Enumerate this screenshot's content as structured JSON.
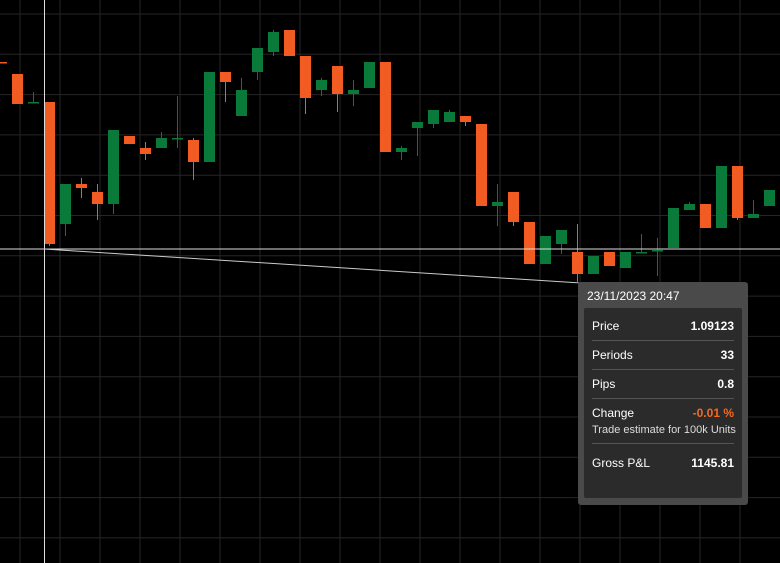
{
  "colors": {
    "background": "#000000",
    "grid": "#262626",
    "bullish": "#0a7a3a",
    "bearish": "#f25c23",
    "crosshair": "#dddddd",
    "negative_change": "#f26a22"
  },
  "chart_data": {
    "type": "candlestick",
    "candles": [
      {
        "dir": "down",
        "open": 1.0956,
        "high": 1.0956,
        "low": 1.0956,
        "close": 1.0956
      },
      {
        "dir": "down",
        "open": 1.0953,
        "high": 1.0953,
        "low": 1.09455,
        "close": 1.09455
      },
      {
        "dir": "flat",
        "open": 1.0946,
        "high": 1.09485,
        "low": 1.0946,
        "close": 1.0946
      },
      {
        "dir": "down",
        "open": 1.0946,
        "high": 1.0946,
        "low": 1.091,
        "close": 1.09105
      },
      {
        "dir": "up",
        "open": 1.09155,
        "high": 1.09255,
        "low": 1.09125,
        "close": 1.09255
      },
      {
        "dir": "down",
        "open": 1.09255,
        "high": 1.0927,
        "low": 1.0922,
        "close": 1.09245
      },
      {
        "dir": "down",
        "open": 1.09235,
        "high": 1.09255,
        "low": 1.09165,
        "close": 1.09205
      },
      {
        "dir": "up",
        "open": 1.09205,
        "high": 1.0938,
        "low": 1.0918,
        "close": 1.0939
      },
      {
        "dir": "down",
        "open": 1.09375,
        "high": 1.09375,
        "low": 1.09355,
        "close": 1.09355
      },
      {
        "dir": "down",
        "open": 1.09345,
        "high": 1.0936,
        "low": 1.09315,
        "close": 1.0933
      },
      {
        "dir": "up",
        "open": 1.09345,
        "high": 1.09385,
        "low": 1.09345,
        "close": 1.0937
      },
      {
        "dir": "flat",
        "open": 1.0937,
        "high": 1.09475,
        "low": 1.09345,
        "close": 1.0937
      },
      {
        "dir": "down",
        "open": 1.09365,
        "high": 1.0937,
        "low": 1.09265,
        "close": 1.0931
      },
      {
        "dir": "up",
        "open": 1.0931,
        "high": 1.09535,
        "low": 1.0931,
        "close": 1.09535
      },
      {
        "dir": "down",
        "open": 1.09535,
        "high": 1.09535,
        "low": 1.0946,
        "close": 1.0951
      },
      {
        "dir": "up",
        "open": 1.09425,
        "high": 1.0952,
        "low": 1.09425,
        "close": 1.0949
      },
      {
        "dir": "up",
        "open": 1.09535,
        "high": 1.09595,
        "low": 1.09515,
        "close": 1.09595
      },
      {
        "dir": "up",
        "open": 1.09585,
        "high": 1.0964,
        "low": 1.09575,
        "close": 1.09635
      },
      {
        "dir": "down",
        "open": 1.0964,
        "high": 1.0964,
        "low": 1.09575,
        "close": 1.09575
      },
      {
        "dir": "down",
        "open": 1.09575,
        "high": 1.09575,
        "low": 1.0943,
        "close": 1.0947
      },
      {
        "dir": "up",
        "open": 1.0949,
        "high": 1.0952,
        "low": 1.09475,
        "close": 1.09515
      },
      {
        "dir": "down",
        "open": 1.0955,
        "high": 1.0955,
        "low": 1.09435,
        "close": 1.0948
      },
      {
        "dir": "up",
        "open": 1.0948,
        "high": 1.09515,
        "low": 1.0945,
        "close": 1.0949
      },
      {
        "dir": "up",
        "open": 1.09495,
        "high": 1.0956,
        "low": 1.09495,
        "close": 1.0956
      },
      {
        "dir": "down",
        "open": 1.0956,
        "high": 1.0956,
        "low": 1.09335,
        "close": 1.09335
      },
      {
        "dir": "up",
        "open": 1.09335,
        "high": 1.0935,
        "low": 1.09315,
        "close": 1.09345
      },
      {
        "dir": "up",
        "open": 1.0941,
        "high": 1.0941,
        "low": 1.09325,
        "close": 1.09395
      },
      {
        "dir": "up",
        "open": 1.0944,
        "high": 1.0944,
        "low": 1.09395,
        "close": 1.09405
      },
      {
        "dir": "up",
        "open": 1.0941,
        "high": 1.0944,
        "low": 1.0941,
        "close": 1.09435
      },
      {
        "dir": "down",
        "open": 1.09425,
        "high": 1.09425,
        "low": 1.094,
        "close": 1.0941
      },
      {
        "dir": "down",
        "open": 1.09405,
        "high": 1.09405,
        "low": 1.092,
        "close": 1.092
      },
      {
        "dir": "up",
        "open": 1.092,
        "high": 1.09255,
        "low": 1.0915,
        "close": 1.0921
      },
      {
        "dir": "down",
        "open": 1.09235,
        "high": 1.09235,
        "low": 1.0915,
        "close": 1.0916
      },
      {
        "dir": "down",
        "open": 1.0916,
        "high": 1.0916,
        "low": 1.09055,
        "close": 1.09055
      },
      {
        "dir": "up",
        "open": 1.09055,
        "high": 1.09125,
        "low": 1.09055,
        "close": 1.09125
      },
      {
        "dir": "up",
        "open": 1.09105,
        "high": 1.0914,
        "low": 1.0908,
        "close": 1.0914
      },
      {
        "dir": "down",
        "open": 1.09085,
        "high": 1.09155,
        "low": 1.0901,
        "close": 1.0903
      },
      {
        "dir": "up",
        "open": 1.0903,
        "high": 1.09075,
        "low": 1.0903,
        "close": 1.09075
      },
      {
        "dir": "down",
        "open": 1.09085,
        "high": 1.09085,
        "low": 1.0905,
        "close": 1.0905
      },
      {
        "dir": "up",
        "open": 1.09045,
        "high": 1.09085,
        "low": 1.09045,
        "close": 1.09085
      },
      {
        "dir": "flat",
        "open": 1.09085,
        "high": 1.0913,
        "low": 1.09085,
        "close": 1.09085
      },
      {
        "dir": "flat",
        "open": 1.0909,
        "high": 1.0912,
        "low": 1.09025,
        "close": 1.0909
      },
      {
        "dir": "up",
        "open": 1.09095,
        "high": 1.09195,
        "low": 1.09095,
        "close": 1.09195
      },
      {
        "dir": "up",
        "open": 1.0919,
        "high": 1.0921,
        "low": 1.0919,
        "close": 1.09205
      },
      {
        "dir": "down",
        "open": 1.09205,
        "high": 1.09205,
        "low": 1.09145,
        "close": 1.09145
      },
      {
        "dir": "up",
        "open": 1.09145,
        "high": 1.093,
        "low": 1.09145,
        "close": 1.093
      },
      {
        "dir": "down",
        "open": 1.093,
        "high": 1.093,
        "low": 1.09165,
        "close": 1.0917
      },
      {
        "dir": "up",
        "open": 1.0917,
        "high": 1.09215,
        "low": 1.0917,
        "close": 1.0918
      },
      {
        "dir": "up",
        "open": 1.092,
        "high": 1.0924,
        "low": 1.092,
        "close": 1.0924
      },
      {
        "dir": "down",
        "open": 1.09235,
        "high": 1.09245,
        "low": 1.0922,
        "close": 1.0922
      }
    ],
    "crosshair_price": 1.091,
    "measure_end_price": 1.09008,
    "grid": true
  },
  "tooltip": {
    "date": "23/11/2023 20:47",
    "price_label": "Price",
    "price_value": "1.09123",
    "periods_label": "Periods",
    "periods_value": "33",
    "pips_label": "Pips",
    "pips_value": "0.8",
    "change_label": "Change",
    "change_value": "-0.01 %",
    "note": "Trade estimate for 100k Units",
    "gross_label": "Gross P&L",
    "gross_value": "1145.81"
  }
}
